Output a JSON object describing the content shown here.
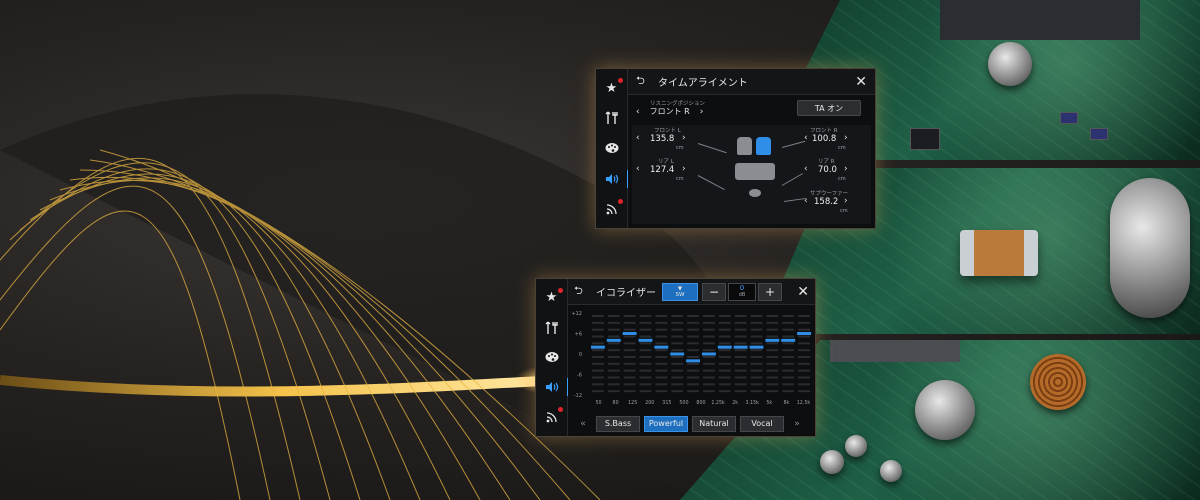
{
  "ta_screen": {
    "title": "タイムアライメント",
    "listening_position_label": "リスニングポジション",
    "listening_position_value": "フロント R",
    "ta_button": "TA オン",
    "speakers": [
      {
        "label": "フロント L",
        "value": "135.8",
        "unit": "cm"
      },
      {
        "label": "フロント R",
        "value": "100.8",
        "unit": "cm"
      },
      {
        "label": "リア L",
        "value": "127.4",
        "unit": "cm"
      },
      {
        "label": "リア R",
        "value": "70.0",
        "unit": "cm"
      },
      {
        "label": "サブウーファー",
        "value": "158.2",
        "unit": "cm"
      }
    ]
  },
  "eq_screen": {
    "title": "イコライザー",
    "sw_label": "SW",
    "minus": "−",
    "plus": "+",
    "db_value": "0",
    "db_unit": "dB",
    "y_ticks": [
      "+12",
      "+6",
      "0",
      "-6",
      "-12"
    ],
    "bands": [
      "50",
      "80",
      "125",
      "200",
      "315",
      "500",
      "800",
      "1.25k",
      "2k",
      "3.15k",
      "5k",
      "8k",
      "12.5k"
    ],
    "band_levels_db": [
      2,
      4,
      6,
      4,
      2,
      0,
      -2,
      0,
      2,
      2,
      2,
      4,
      4,
      6
    ],
    "presets": [
      "S.Bass",
      "Powerful",
      "Natural",
      "Vocal"
    ],
    "active_preset": "Powerful",
    "prev": "«",
    "next": "»"
  },
  "sidebar": {
    "icons": [
      "star-icon",
      "tools-icon",
      "palette-icon",
      "speaker-icon",
      "wireless-icon"
    ],
    "active_index": 3
  },
  "colors": {
    "accent_blue": "#2f8fe8",
    "notification_red": "#e0242c",
    "gold": "#f0b53c"
  }
}
